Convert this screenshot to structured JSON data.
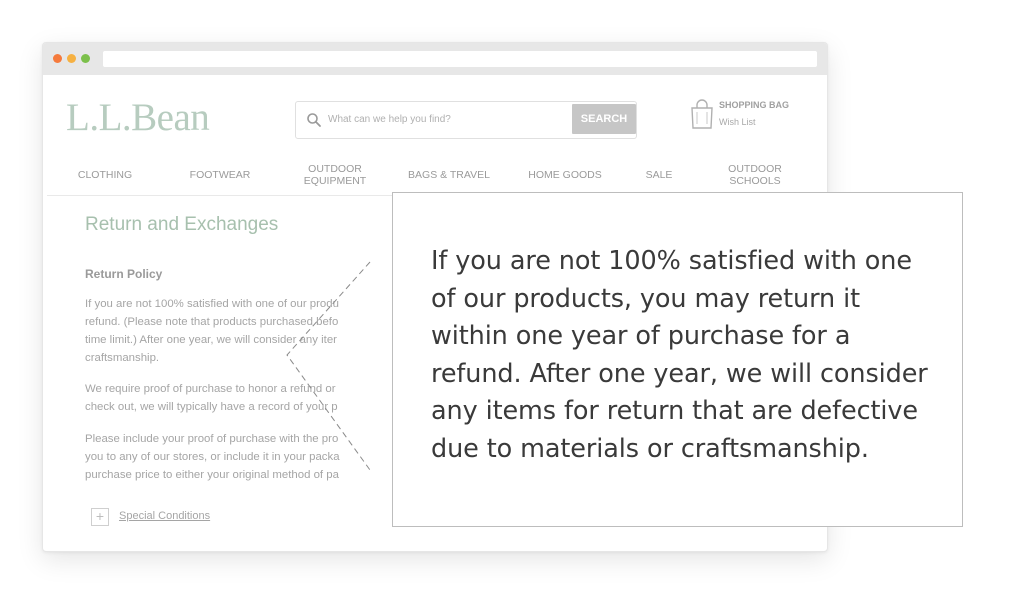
{
  "browser": {
    "dots": [
      "red",
      "yellow",
      "green"
    ]
  },
  "header": {
    "logo": "L.L.Bean",
    "search_placeholder": "What can we help you find?",
    "search_button": "SEARCH",
    "bag_title": "SHOPPING BAG",
    "wish_list": "Wish List"
  },
  "nav": {
    "items": [
      {
        "label": "CLOTHING"
      },
      {
        "label": "FOOTWEAR"
      },
      {
        "label": "OUTDOOR EQUIPMENT"
      },
      {
        "label": "BAGS & TRAVEL"
      },
      {
        "label": "HOME GOODS"
      },
      {
        "label": "SALE"
      },
      {
        "label": "OUTDOOR SCHOOLS"
      }
    ]
  },
  "content": {
    "title": "Return and Exchanges",
    "policy_heading": "Return Policy",
    "paragraphs": [
      [
        "If you are not 100% satisfied with one of our produ",
        "refund. (Please note that products purchased befo",
        "time limit.) After one year, we will consider any iter",
        "craftsmanship."
      ],
      [
        "We require proof of purchase to honor a refund or",
        "check out, we will typically have a record of your p"
      ],
      [
        "Please include your proof of purchase with the pro",
        "you to any of our stores, or include it in your packa",
        "purchase price to either your original method of pa"
      ]
    ],
    "special_conditions": "Special Conditions"
  },
  "callout": {
    "text": "If you are not 100% satisfied with one of our products, you may return it within one year of purchase for a refund. After one year, we will consider any items for return that are defective due to materials or craftsmanship."
  },
  "colors": {
    "logo": "#b7ccbf",
    "title": "#a7c0ae",
    "search_button_bg": "#c6c6c6",
    "callout_text": "#3a3a3a"
  }
}
